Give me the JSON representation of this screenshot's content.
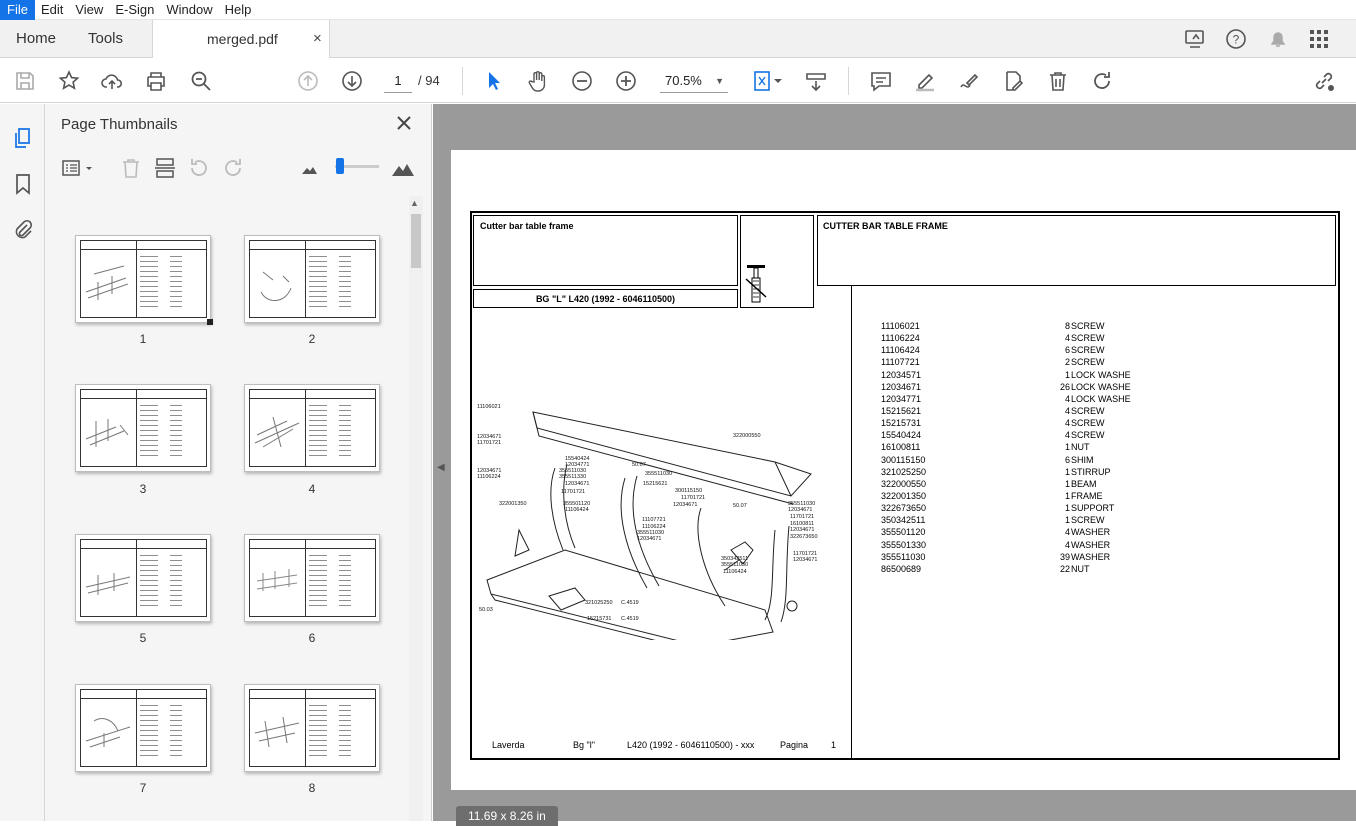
{
  "menu": {
    "items": [
      "File",
      "Edit",
      "View",
      "E-Sign",
      "Window",
      "Help"
    ]
  },
  "tabs": {
    "home": "Home",
    "tools": "Tools",
    "document": "merged.pdf",
    "close": "×"
  },
  "toolbar": {
    "page_current": "1",
    "page_total": "/ 94",
    "zoom": "70.5%"
  },
  "panel": {
    "title": "Page Thumbnails",
    "thumbnails": [
      "1",
      "2",
      "3",
      "4",
      "5",
      "6",
      "7",
      "8"
    ],
    "zoom_slider_fraction": 0.05
  },
  "page_size_label": "11.69 x 8.26 in",
  "pdf": {
    "title_left": "Cutter bar table frame",
    "title_right": "CUTTER BAR TABLE FRAME",
    "model": "BG \"L\"  L420  (1992 - 6046110500)",
    "parts": [
      {
        "code": "11106021",
        "qty": "8",
        "desc": "SCREW"
      },
      {
        "code": "11106224",
        "qty": "4",
        "desc": "SCREW"
      },
      {
        "code": "11106424",
        "qty": "6",
        "desc": "SCREW"
      },
      {
        "code": "11107721",
        "qty": "2",
        "desc": "SCREW"
      },
      {
        "code": "12034571",
        "qty": "1",
        "desc": "LOCK WASHE"
      },
      {
        "code": "12034671",
        "qty": "26",
        "desc": "LOCK WASHE"
      },
      {
        "code": "12034771",
        "qty": "4",
        "desc": "LOCK WASHE"
      },
      {
        "code": "15215621",
        "qty": "4",
        "desc": "SCREW"
      },
      {
        "code": "15215731",
        "qty": "4",
        "desc": "SCREW"
      },
      {
        "code": "15540424",
        "qty": "4",
        "desc": "SCREW"
      },
      {
        "code": "16100811",
        "qty": "1",
        "desc": "NUT"
      },
      {
        "code": "300115150",
        "qty": "6",
        "desc": "SHIM"
      },
      {
        "code": "321025250",
        "qty": "1",
        "desc": "STIRRUP"
      },
      {
        "code": "322000550",
        "qty": "1",
        "desc": "BEAM"
      },
      {
        "code": "322001350",
        "qty": "1",
        "desc": "FRAME"
      },
      {
        "code": "322673650",
        "qty": "1",
        "desc": "SUPPORT"
      },
      {
        "code": "350342511",
        "qty": "1",
        "desc": "SCREW"
      },
      {
        "code": "355501120",
        "qty": "4",
        "desc": "WASHER"
      },
      {
        "code": "355501330",
        "qty": "4",
        "desc": "WASHER"
      },
      {
        "code": "355511030",
        "qty": "39",
        "desc": "WASHER"
      },
      {
        "code": "86500689",
        "qty": "22",
        "desc": "NUT"
      }
    ],
    "footer": {
      "brand": "Laverda",
      "group": "Bg \"l\"",
      "model": "L420  (1992 - 6046110500) - xxx",
      "page_label": "Pagina",
      "page_num": "1"
    },
    "diagram_labels": [
      "11106021",
      "12034671",
      "11701721",
      "12034671",
      "11106224",
      "15540424",
      "12034771",
      "355511030",
      "355511330",
      "12034671",
      "11701721",
      "322001350",
      "355501120",
      "11106424",
      "322000550",
      "50.07",
      "355511030",
      "15215621",
      "300115150",
      "11701721",
      "12034671",
      "11107721",
      "11106224",
      "355511030",
      "12034671",
      "50.07",
      "355511030",
      "12034671",
      "11701721",
      "16100811",
      "12034671",
      "322673650",
      "350342511",
      "355511030",
      "11106424",
      "11701721",
      "12034671",
      "321025250",
      "C.4519",
      "15215731",
      "C.4519",
      "50.03"
    ]
  }
}
